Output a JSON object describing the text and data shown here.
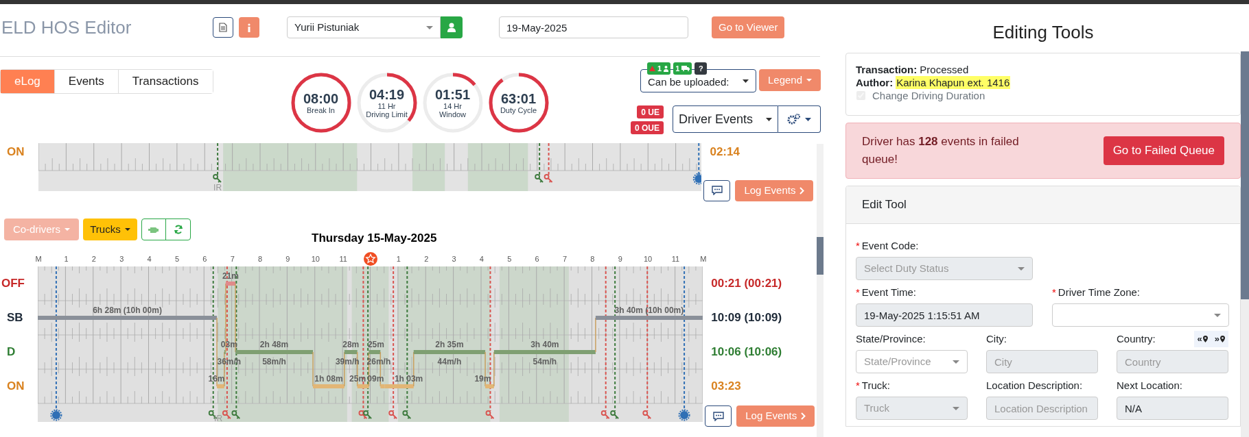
{
  "header": {
    "title": "ELD HOS Editor",
    "driver": "Yurii Pistuniak",
    "date": "19-May-2025",
    "viewer_button": "Go to Viewer"
  },
  "tabs": [
    {
      "label": "eLog",
      "selected": true
    },
    {
      "label": "Events",
      "selected": false
    },
    {
      "label": "Transactions",
      "selected": false
    }
  ],
  "gauges": [
    {
      "value": "08:00",
      "caption": [
        "Break In"
      ],
      "level": 1
    },
    {
      "value": "04:19",
      "caption": [
        "11 Hr",
        "Driving Limit"
      ],
      "level": 0.36
    },
    {
      "value": "01:51",
      "caption": [
        "14 Hr",
        "Window"
      ],
      "level": 0.14
    },
    {
      "value": "63:01",
      "caption": [
        "Duty Cycle"
      ],
      "level": 0.9
    }
  ],
  "badges": [
    {
      "kind": "alert",
      "text": "1"
    },
    {
      "kind": "truck",
      "text": "1"
    },
    {
      "kind": "help",
      "text": "?"
    }
  ],
  "upload_select": "Can be uploaded:",
  "legend_button": "Legend",
  "ue_badges": [
    "0 UE",
    "0 OUE"
  ],
  "events_select": "Driver Events",
  "top_log": {
    "rows": [
      {
        "status": "ON",
        "total": "02:14"
      }
    ],
    "marker_label": "IR",
    "log_button": "Log Events"
  },
  "toolbar": {
    "codrivers": "Co-drivers",
    "trucks": "Trucks"
  },
  "day_title": "Thursday 15-May-2025",
  "hours": [
    {
      "label": "M"
    },
    {
      "label": "1"
    },
    {
      "label": "2"
    },
    {
      "label": "3"
    },
    {
      "label": "4"
    },
    {
      "label": "5"
    },
    {
      "label": "6"
    },
    {
      "label": "7"
    },
    {
      "label": "8"
    },
    {
      "label": "9"
    },
    {
      "label": "10"
    },
    {
      "label": "11"
    },
    {
      "kind": "star"
    },
    {
      "label": "1"
    },
    {
      "label": "2"
    },
    {
      "label": "3"
    },
    {
      "label": "4"
    },
    {
      "label": "5"
    },
    {
      "label": "6"
    },
    {
      "label": "7"
    },
    {
      "label": "8"
    },
    {
      "label": "9"
    },
    {
      "label": "10"
    },
    {
      "label": "11"
    },
    {
      "label": "M"
    }
  ],
  "rows": [
    {
      "status": "OFF",
      "total": "00:21 (00:21)",
      "segments": [
        {
          "duration": "21m"
        }
      ]
    },
    {
      "status": "SB",
      "total": "10:09 (10:09)",
      "segments": [
        {
          "duration": "6h 28m (10h 00m)"
        },
        {
          "duration": "3h 40m (10h 00m)"
        }
      ]
    },
    {
      "status": "D",
      "total": "10:06 (10:06)",
      "segments": [
        {
          "duration": "03m",
          "speed": "36m/h"
        },
        {
          "duration": "2h 48m",
          "speed": "58m/h"
        },
        {
          "duration": "28m",
          "speed": "39m/h"
        },
        {
          "duration": "25m",
          "speed": "26m/h"
        },
        {
          "duration": "2h 35m",
          "speed": "44m/h"
        },
        {
          "duration": "3h 40m",
          "speed": "54m/h"
        }
      ]
    },
    {
      "status": "ON",
      "total": "03:23",
      "segments": [
        {
          "duration": "16m"
        },
        {
          "duration": "1h 08m"
        },
        {
          "duration": "25m"
        },
        {
          "duration": "09m"
        },
        {
          "duration": "1h 03m"
        },
        {
          "duration": "19m"
        }
      ]
    }
  ],
  "marker_label": "IR",
  "log_button": "Log Events",
  "editing": {
    "title": "Editing Tools",
    "transaction_label": "Transaction:",
    "transaction": "Processed",
    "author_label": "Author:",
    "author": "Karina Khapun ext. 1416",
    "change_driving": {
      "label": "Change Driving Duration",
      "checked": true,
      "disabled": true
    }
  },
  "alert": {
    "text": "Driver has **128** events in failed queue!",
    "button": "Go to Failed Queue"
  },
  "edit_tool": {
    "title": "Edit Tool",
    "rows": [
      [
        {
          "mark": "*",
          "label": "Event Code:",
          "kind": "select",
          "placeholder": "Select Duty Status",
          "disabled": true
        }
      ],
      [
        {
          "mark": "*",
          "label": "Event Time:",
          "kind": "input",
          "value": "19-May-2025 1:15:51 AM",
          "disabled": true
        },
        {
          "mark": "*",
          "label": "Driver Time Zone:",
          "kind": "select",
          "disabled": false
        }
      ],
      [
        {
          "label": "State/Province:",
          "kind": "select",
          "placeholder": "State/Province",
          "disabled": false
        },
        {
          "label": "City:",
          "kind": "input",
          "placeholder": "City",
          "disabled": true
        },
        {
          "label": "Country:",
          "kind": "input",
          "placeholder": "Country",
          "disabled": true,
          "nav": [
            "«",
            "»"
          ]
        }
      ],
      [
        {
          "mark": "*",
          "label": "Truck:",
          "kind": "select",
          "placeholder": "Truck",
          "disabled": true
        },
        {
          "label": "Location Description:",
          "kind": "input",
          "placeholder": "Location Description",
          "disabled": true
        },
        {
          "label": "Next Location:",
          "kind": "input",
          "value": "N/A",
          "disabled": true
        }
      ]
    ]
  }
}
